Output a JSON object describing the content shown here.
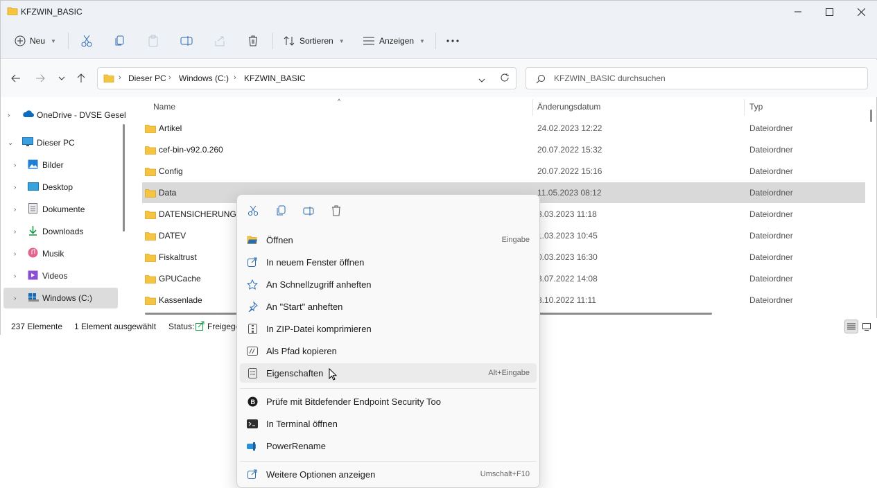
{
  "window": {
    "title": "KFZWIN_BASIC"
  },
  "toolbar": {
    "new_label": "Neu",
    "sort_label": "Sortieren",
    "view_label": "Anzeigen"
  },
  "address": {
    "crumbs": [
      "Dieser PC",
      "Windows (C:)",
      "KFZWIN_BASIC"
    ]
  },
  "search": {
    "placeholder": "KFZWIN_BASIC durchsuchen"
  },
  "sidebar": {
    "items": [
      {
        "label": "OneDrive - DVSE Gesel"
      },
      {
        "label": "Dieser PC"
      },
      {
        "label": "Bilder"
      },
      {
        "label": "Desktop"
      },
      {
        "label": "Dokumente"
      },
      {
        "label": "Downloads"
      },
      {
        "label": "Musik"
      },
      {
        "label": "Videos"
      },
      {
        "label": "Windows (C:)"
      }
    ]
  },
  "columns": {
    "name": "Name",
    "date": "Änderungsdatum",
    "type": "Typ"
  },
  "files": [
    {
      "name": "Artikel",
      "date": "24.02.2023 12:22",
      "type": "Dateiordner"
    },
    {
      "name": "cef-bin-v92.0.260",
      "date": "20.07.2022 15:32",
      "type": "Dateiordner"
    },
    {
      "name": "Config",
      "date": "20.07.2022 15:16",
      "type": "Dateiordner"
    },
    {
      "name": "Data",
      "date": "11.05.2023 08:12",
      "type": "Dateiordner"
    },
    {
      "name": "DATENSICHERUNG",
      "date": "3.03.2023 11:18",
      "type": "Dateiordner"
    },
    {
      "name": "DATEV",
      "date": "1.03.2023 10:45",
      "type": "Dateiordner"
    },
    {
      "name": "Fiskaltrust",
      "date": "0.03.2023 16:30",
      "type": "Dateiordner"
    },
    {
      "name": "GPUCache",
      "date": "3.07.2022 14:08",
      "type": "Dateiordner"
    },
    {
      "name": "Kassenlade",
      "date": "8.10.2022 11:11",
      "type": "Dateiordner"
    }
  ],
  "status": {
    "count": "237 Elemente",
    "selected": "1 Element ausgewählt",
    "status_label": "Status:",
    "status_value": "Freigege"
  },
  "context_menu": {
    "items": [
      {
        "label": "Öffnen",
        "shortcut": "Eingabe",
        "icon": "folder-open-icon"
      },
      {
        "label": "In neuem Fenster öffnen",
        "icon": "new-window-icon"
      },
      {
        "label": "An Schnellzugriff anheften",
        "icon": "star-icon"
      },
      {
        "label": "An \"Start\" anheften",
        "icon": "pin-icon"
      },
      {
        "label": "In ZIP-Datei komprimieren",
        "icon": "zip-icon"
      },
      {
        "label": "Als Pfad kopieren",
        "icon": "copy-path-icon"
      },
      {
        "label": "Eigenschaften",
        "shortcut": "Alt+Eingabe",
        "icon": "properties-icon"
      },
      {
        "label": "Prüfe mit Bitdefender Endpoint Security Too",
        "icon": "bitdefender-icon"
      },
      {
        "label": "In  Terminal öffnen",
        "icon": "terminal-icon"
      },
      {
        "label": "PowerRename",
        "icon": "powerrename-icon"
      },
      {
        "label": "Weitere Optionen anzeigen",
        "shortcut": "Umschalt+F10",
        "icon": "more-options-icon"
      }
    ]
  },
  "colors": {
    "accent": "#2b6cb0",
    "folder": "#f5c542",
    "selection": "#d9d9d9"
  }
}
